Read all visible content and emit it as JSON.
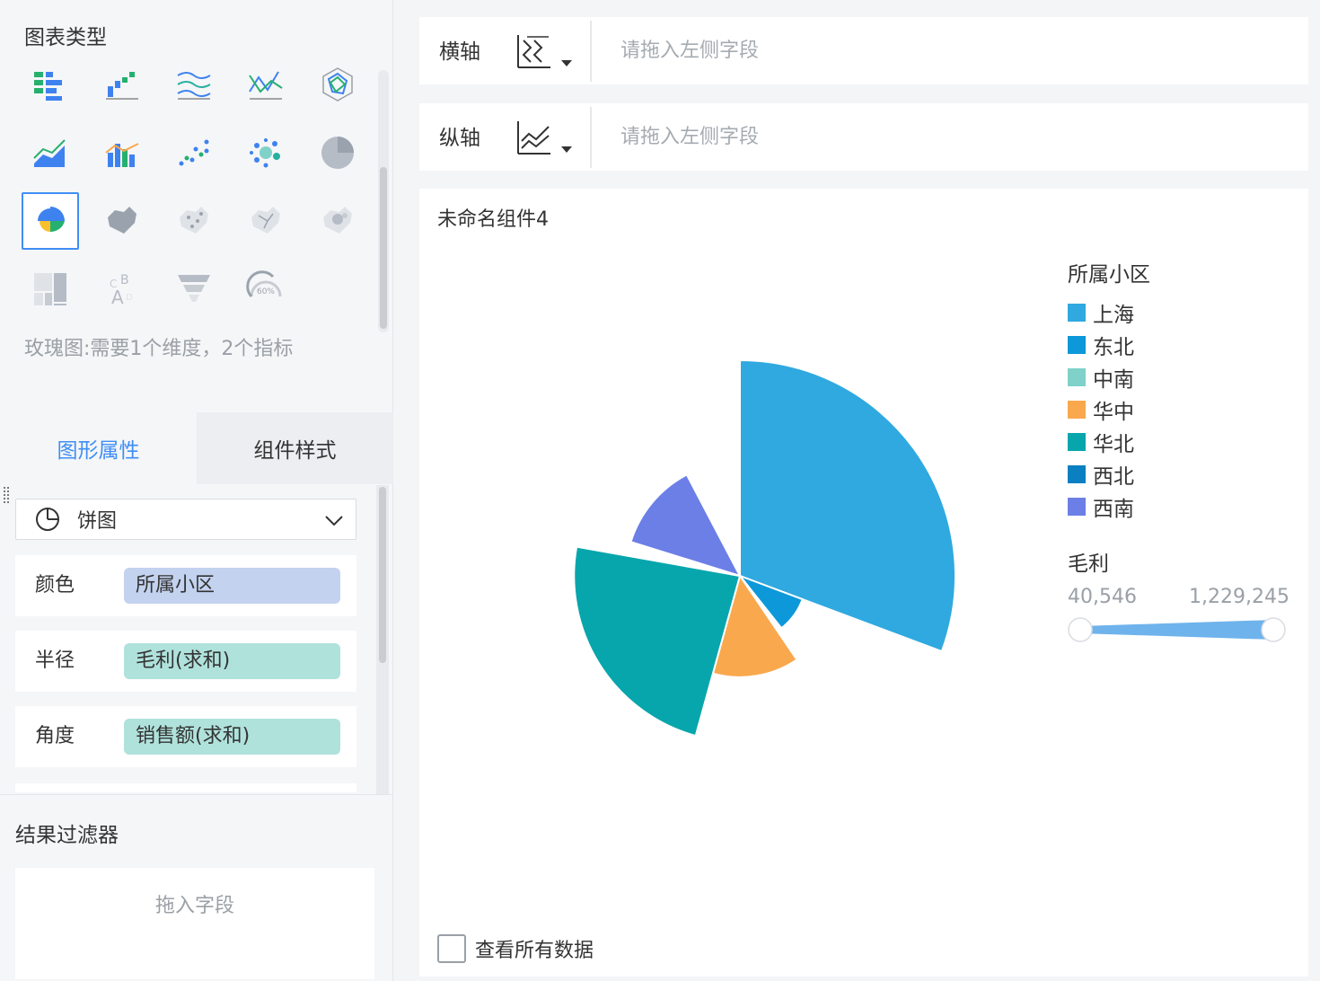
{
  "left": {
    "chart_type_title": "图表类型",
    "type_hint": "玫瑰图:需要1个维度，2个指标",
    "chart_types": [
      "grouped-table-icon",
      "cross-table-icon",
      "multi-line-icon",
      "line-chart-icon",
      "radar-chart-icon",
      "area-chart-icon",
      "combo-chart-icon",
      "scatter-chart-icon",
      "bubble-chart-icon",
      "pie-chart-icon",
      "rose-chart-icon",
      "region-map-icon",
      "point-map-icon",
      "flow-map-icon",
      "heat-map-icon",
      "treemap-icon",
      "word-cloud-icon",
      "funnel-chart-icon",
      "gauge-chart-icon"
    ],
    "gauge_text": "60%",
    "tabs": {
      "active": "图形属性",
      "inactive": "组件样式"
    },
    "chart_select": {
      "value": "饼图"
    },
    "props": [
      {
        "name": "颜色",
        "field": "所属小区"
      },
      {
        "name": "半径",
        "field": "毛利(求和)"
      },
      {
        "name": "角度",
        "field": "销售额(求和)"
      }
    ],
    "filter": {
      "title": "结果过滤器",
      "drop": "拖入字段"
    }
  },
  "axes": {
    "x": {
      "name": "横轴",
      "placeholder": "请拖入左侧字段"
    },
    "y": {
      "name": "纵轴",
      "placeholder": "请拖入左侧字段"
    }
  },
  "card": {
    "title": "未命名组件4",
    "view_all": "查看所有数据"
  },
  "legend": {
    "title": "所属小区",
    "items": [
      {
        "label": "上海",
        "color": "#2fa9e0"
      },
      {
        "label": "东北",
        "color": "#0d98d9"
      },
      {
        "label": "中南",
        "color": "#7fd1c9"
      },
      {
        "label": "华中",
        "color": "#f9a84d"
      },
      {
        "label": "华北",
        "color": "#07a6ad"
      },
      {
        "label": "西北",
        "color": "#0a7fc2"
      },
      {
        "label": "西南",
        "color": "#6b7fe6"
      }
    ],
    "size_title": "毛利",
    "size_min": "40,546",
    "size_max": "1,229,245"
  },
  "chart_data": {
    "type": "pie",
    "variant": "rose",
    "dimension": "所属小区",
    "angle_measure": "销售额(求和)",
    "radius_measure": "毛利(求和)",
    "series": [
      {
        "name": "上海",
        "angle_share": 0.307,
        "radius_rel": 1.0
      },
      {
        "name": "东北",
        "angle_share": 0.086,
        "radius_rel": 0.31
      },
      {
        "name": "中南",
        "angle_share": 0.012,
        "radius_rel": 0.06
      },
      {
        "name": "华中",
        "angle_share": 0.138,
        "radius_rel": 0.47
      },
      {
        "name": "华北",
        "angle_share": 0.235,
        "radius_rel": 0.77
      },
      {
        "name": "西北",
        "angle_share": 0.02,
        "radius_rel": 0.04
      },
      {
        "name": "西南",
        "angle_share": 0.125,
        "radius_rel": 0.53
      }
    ]
  }
}
